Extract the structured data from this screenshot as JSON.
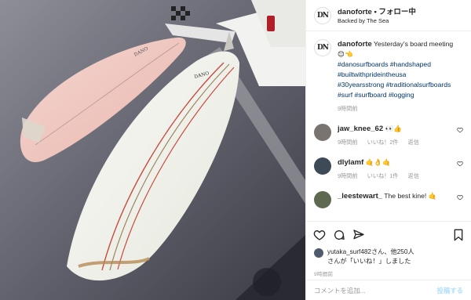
{
  "header": {
    "username": "danoforte",
    "separator": " • ",
    "follow_label": "フォロー中",
    "location": "Backed by The Sea"
  },
  "caption": {
    "username": "danoforte",
    "text": "Yesterday's board meeting",
    "emoji": "😊👈",
    "hashtags": [
      "#danosurfboards",
      "#handshaped",
      "#builtwithprideintheusa",
      "#30yearsstrong",
      "#traditionalsurfboards",
      "#surf",
      "#surfboard",
      "#logging"
    ],
    "time": "9時間前"
  },
  "comments": [
    {
      "username": "jaw_knee_62",
      "text": "👀👍",
      "time": "9時間前",
      "likes": "いいね！2件",
      "reply": "返信"
    },
    {
      "username": "dlylamf",
      "text": "🤙👌🤙",
      "time": "9時間前",
      "likes": "いいね！1件",
      "reply": "返信"
    },
    {
      "username": "_leestewart_",
      "text": "The best kine!",
      "emoji": "🤙",
      "time": "",
      "likes": "",
      "reply": ""
    }
  ],
  "likes": {
    "line1": "yutaka_surf482さん、他250人",
    "line2": "さんが「いいね！」しました"
  },
  "post_time": "9時間前",
  "add_comment": {
    "placeholder": "コメントを追加...",
    "post_label": "投稿する"
  },
  "photo_board_brand": "DANO"
}
